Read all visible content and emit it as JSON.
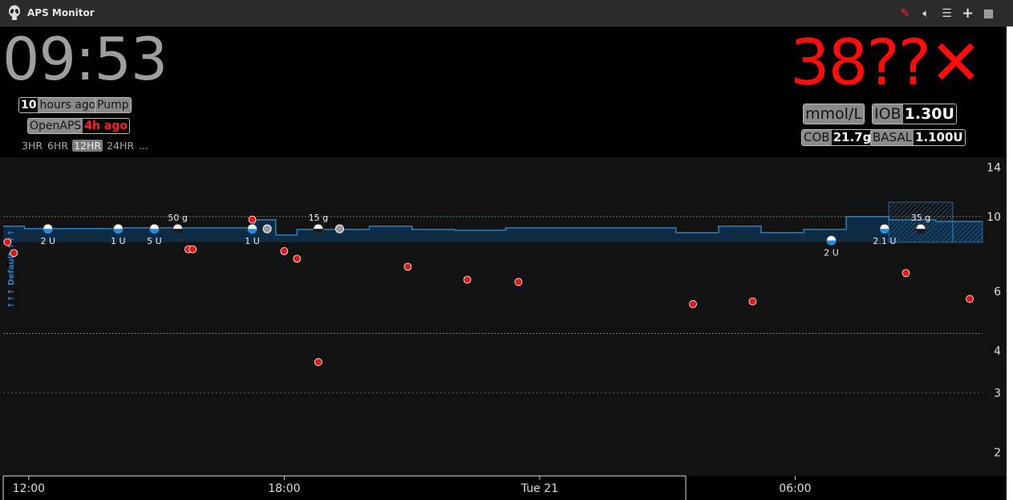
{
  "window": {
    "title": "APS Monitor",
    "icons": [
      "edit-icon",
      "volume-icon",
      "menu-icon",
      "add-icon",
      "calculator-icon"
    ]
  },
  "clock": "09:53",
  "status": {
    "last_bg_value": "10",
    "last_bg_suffix": "hours ago",
    "device": "Pump",
    "loop_label": "OpenAPS",
    "loop_age": "4h ago"
  },
  "time_ranges": [
    "3HR",
    "6HR",
    "12HR",
    "24HR",
    "..."
  ],
  "selected_range": "12HR",
  "reading": {
    "value": "38",
    "suffix": "??",
    "direction": "✕",
    "units": "mmol/L"
  },
  "pills": {
    "iob_label": "IOB",
    "iob_value": "1.30U",
    "cob_label": "COB",
    "cob_value": "21.7g",
    "basal_label": "BASAL",
    "basal_value": "1.100U"
  },
  "colors": {
    "bg_red": "#ff0c0c",
    "basal_blue": "#2d7fc1",
    "chart_bg": "#121212"
  },
  "chart_data": {
    "type": "scatter",
    "y_scale": "log",
    "ylim": [
      1.7,
      15
    ],
    "y_ticks": [
      14,
      10,
      6,
      4,
      3,
      2
    ],
    "target_low": 4.5,
    "target_high": 10,
    "x_ticks": [
      "12:00",
      "18:00",
      "Tue 21",
      "06:00"
    ],
    "xlim_hours": [
      10.9,
      33.9
    ],
    "x_tick_hours": [
      11.5,
      17.5,
      23.5,
      29.5
    ],
    "profile_label": "↑↑↑ Default ↑↑↑",
    "bg_points": [
      {
        "t": 11.0,
        "y": 8.4
      },
      {
        "t": 11.15,
        "y": 7.8
      },
      {
        "t": 15.25,
        "y": 8.0
      },
      {
        "t": 15.35,
        "y": 8.0
      },
      {
        "t": 16.75,
        "y": 9.8
      },
      {
        "t": 17.5,
        "y": 7.9
      },
      {
        "t": 17.8,
        "y": 7.5
      },
      {
        "t": 18.3,
        "y": 3.7
      },
      {
        "t": 20.4,
        "y": 7.1
      },
      {
        "t": 21.8,
        "y": 6.5
      },
      {
        "t": 23.0,
        "y": 6.4
      },
      {
        "t": 27.1,
        "y": 5.5
      },
      {
        "t": 28.5,
        "y": 5.6
      },
      {
        "t": 32.1,
        "y": 6.8
      },
      {
        "t": 33.6,
        "y": 5.7
      }
    ],
    "treatments": [
      {
        "t": 11.95,
        "type": "bolus",
        "label": "2 U",
        "y": 9.2
      },
      {
        "t": 13.6,
        "type": "bolus",
        "label": "1 U",
        "y": 9.2
      },
      {
        "t": 14.45,
        "type": "bolus",
        "label": "5 U",
        "y": 9.2
      },
      {
        "t": 15.0,
        "type": "carbs",
        "label": "50 g",
        "y": 9.2
      },
      {
        "t": 16.75,
        "type": "bolus",
        "label": "1 U",
        "y": 9.2
      },
      {
        "t": 17.1,
        "type": "carbs",
        "label": "",
        "y": 9.2
      },
      {
        "t": 18.3,
        "type": "carbs",
        "label": "15 g",
        "y": 9.2
      },
      {
        "t": 18.8,
        "type": "carbs",
        "label": "",
        "y": 9.2
      },
      {
        "t": 30.35,
        "type": "bolus",
        "label": "2 U",
        "y": 8.5
      },
      {
        "t": 31.6,
        "type": "bolus",
        "label": "2.1 U",
        "y": 9.2
      },
      {
        "t": 32.45,
        "type": "carbs",
        "label": "35 g",
        "y": 9.2
      }
    ],
    "basal_steps": [
      {
        "t": 10.9,
        "rate": 1.0
      },
      {
        "t": 11.4,
        "rate": 0.85
      },
      {
        "t": 13.6,
        "rate": 0.9
      },
      {
        "t": 16.8,
        "rate": 1.4
      },
      {
        "t": 17.3,
        "rate": 0.45
      },
      {
        "t": 17.8,
        "rate": 0.8
      },
      {
        "t": 19.5,
        "rate": 1.0
      },
      {
        "t": 20.5,
        "rate": 0.8
      },
      {
        "t": 21.5,
        "rate": 0.75
      },
      {
        "t": 22.7,
        "rate": 0.9
      },
      {
        "t": 26.7,
        "rate": 0.6
      },
      {
        "t": 27.7,
        "rate": 1.0
      },
      {
        "t": 28.7,
        "rate": 0.6
      },
      {
        "t": 29.7,
        "rate": 0.8
      },
      {
        "t": 30.7,
        "rate": 1.6
      },
      {
        "t": 31.7,
        "rate": 1.4
      },
      {
        "t": 32.8,
        "rate": 1.3
      }
    ],
    "basal_max_rate": 3.0,
    "temp_basal": [
      {
        "t0": 31.7,
        "t1": 33.2,
        "rate": 2.5
      },
      {
        "t0": 33.2,
        "t1": 33.9,
        "rate": 1.3
      }
    ]
  }
}
